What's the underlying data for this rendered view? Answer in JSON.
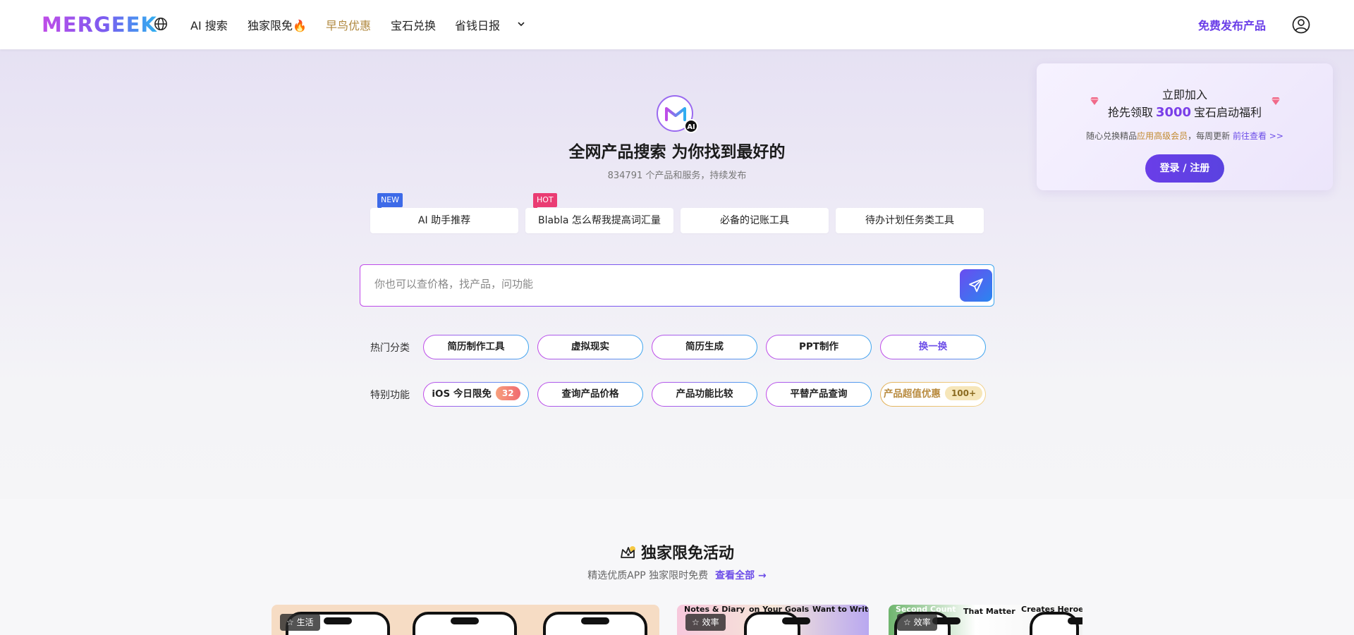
{
  "header": {
    "logo": "MERGEEK",
    "nav": [
      {
        "label": "AI 搜索"
      },
      {
        "label": "独家限免🔥"
      },
      {
        "label": "早鸟优惠"
      },
      {
        "label": "宝石兑换"
      },
      {
        "label": "省钱日报"
      }
    ],
    "publish_label": "免费发布产品"
  },
  "hero": {
    "title": "全网产品搜索 为你找到最好的",
    "subtitle": "834791 个产品和服务，持续发布",
    "logo_badge": "AI",
    "suggestions": [
      {
        "label": "AI 助手推荐",
        "badge": "NEW"
      },
      {
        "label": "Blabla 怎么帮我提高词汇量",
        "badge": "HOT"
      },
      {
        "label": "必备的记账工具"
      },
      {
        "label": "待办计划任务类工具"
      }
    ],
    "search_placeholder": "你也可以查价格，找产品，问功能",
    "hot_label": "热门分类",
    "hot_categories": [
      "简历制作工具",
      "虚拟现实",
      "简历生成",
      "PPT制作"
    ],
    "refresh_label": "换一换",
    "special_label": "特别功能",
    "special_features": [
      {
        "label": "iOS 今日限免",
        "count": "32"
      },
      {
        "label": "查询产品价格"
      },
      {
        "label": "产品功能比较"
      },
      {
        "label": "平替产品查询"
      },
      {
        "label": "产品超值优惠",
        "count": "100+"
      }
    ]
  },
  "signup_card": {
    "line1": "立即加入",
    "line2_prefix": "抢先领取",
    "line2_number": "3000",
    "line2_suffix": "宝石启动福利",
    "line3_prefix": "随心兑换精品",
    "line3_highlight": "应用高级会员",
    "line3_mid": "，每周更新",
    "line3_link": "前往查看 >>",
    "button": "登录 / 注册"
  },
  "section": {
    "title": "独家限免活动",
    "subtitle": "精选优质APP 独家限时免费",
    "view_all": "查看全部 →",
    "cards": [
      {
        "tag": "生活"
      },
      {
        "tag": "效率",
        "captions": [
          "Notes & Diary",
          "on Your Goals",
          "Want to Write"
        ]
      },
      {
        "tag": "效率",
        "captions": [
          "Second Count",
          "That Matter",
          "Creates Heroes"
        ]
      }
    ]
  },
  "colors": {
    "accent": "#6a3ee8",
    "gold": "#b0883f",
    "new_badge": "#3d6ae8",
    "hot_badge": "#ea3c73"
  }
}
